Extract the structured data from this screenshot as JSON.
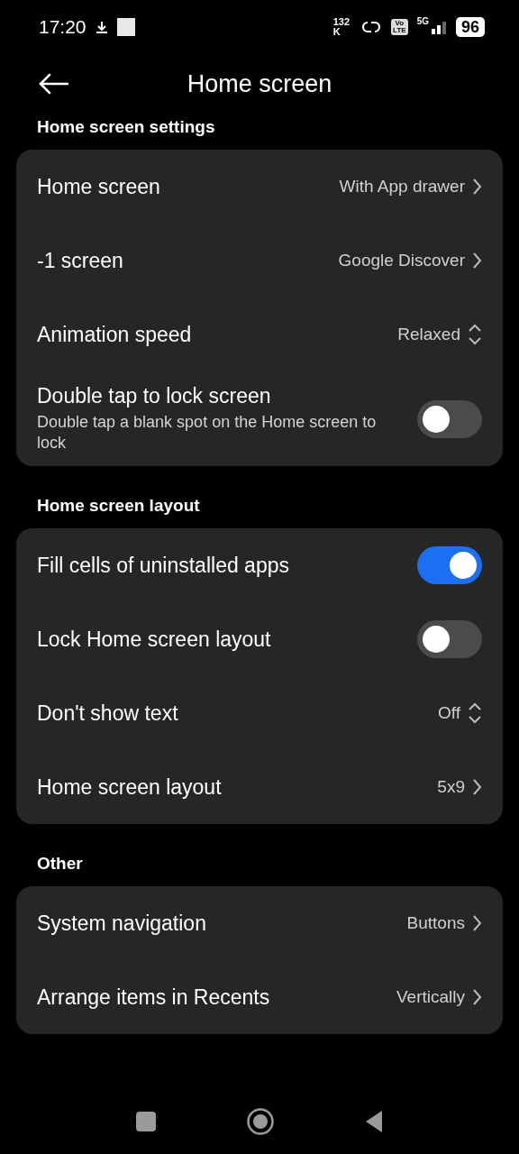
{
  "status_bar": {
    "time": "17:20",
    "speed_value": "132",
    "speed_unit": "K",
    "volte_top": "Vo",
    "volte_bottom": "LTE",
    "network": "5G",
    "battery": "96"
  },
  "header": {
    "title": "Home screen"
  },
  "sections": [
    {
      "title": "Home screen settings",
      "rows": [
        {
          "kind": "link",
          "title": "Home screen",
          "value": "With App drawer"
        },
        {
          "kind": "link",
          "title": "-1 screen",
          "value": "Google Discover"
        },
        {
          "kind": "select",
          "title": "Animation speed",
          "value": "Relaxed"
        },
        {
          "kind": "toggle",
          "title": "Double tap to lock screen",
          "subtitle": "Double tap a blank spot on the Home screen to lock",
          "on": false
        }
      ]
    },
    {
      "title": "Home screen layout",
      "rows": [
        {
          "kind": "toggle",
          "title": "Fill cells of uninstalled apps",
          "on": true
        },
        {
          "kind": "toggle",
          "title": "Lock Home screen layout",
          "on": false
        },
        {
          "kind": "select",
          "title": "Don't show text",
          "value": "Off"
        },
        {
          "kind": "link",
          "title": "Home screen layout",
          "value": "5x9"
        }
      ]
    },
    {
      "title": "Other",
      "rows": [
        {
          "kind": "link",
          "title": "System navigation",
          "value": "Buttons"
        },
        {
          "kind": "link",
          "title": "Arrange items in Recents",
          "value": "Vertically"
        }
      ]
    }
  ]
}
